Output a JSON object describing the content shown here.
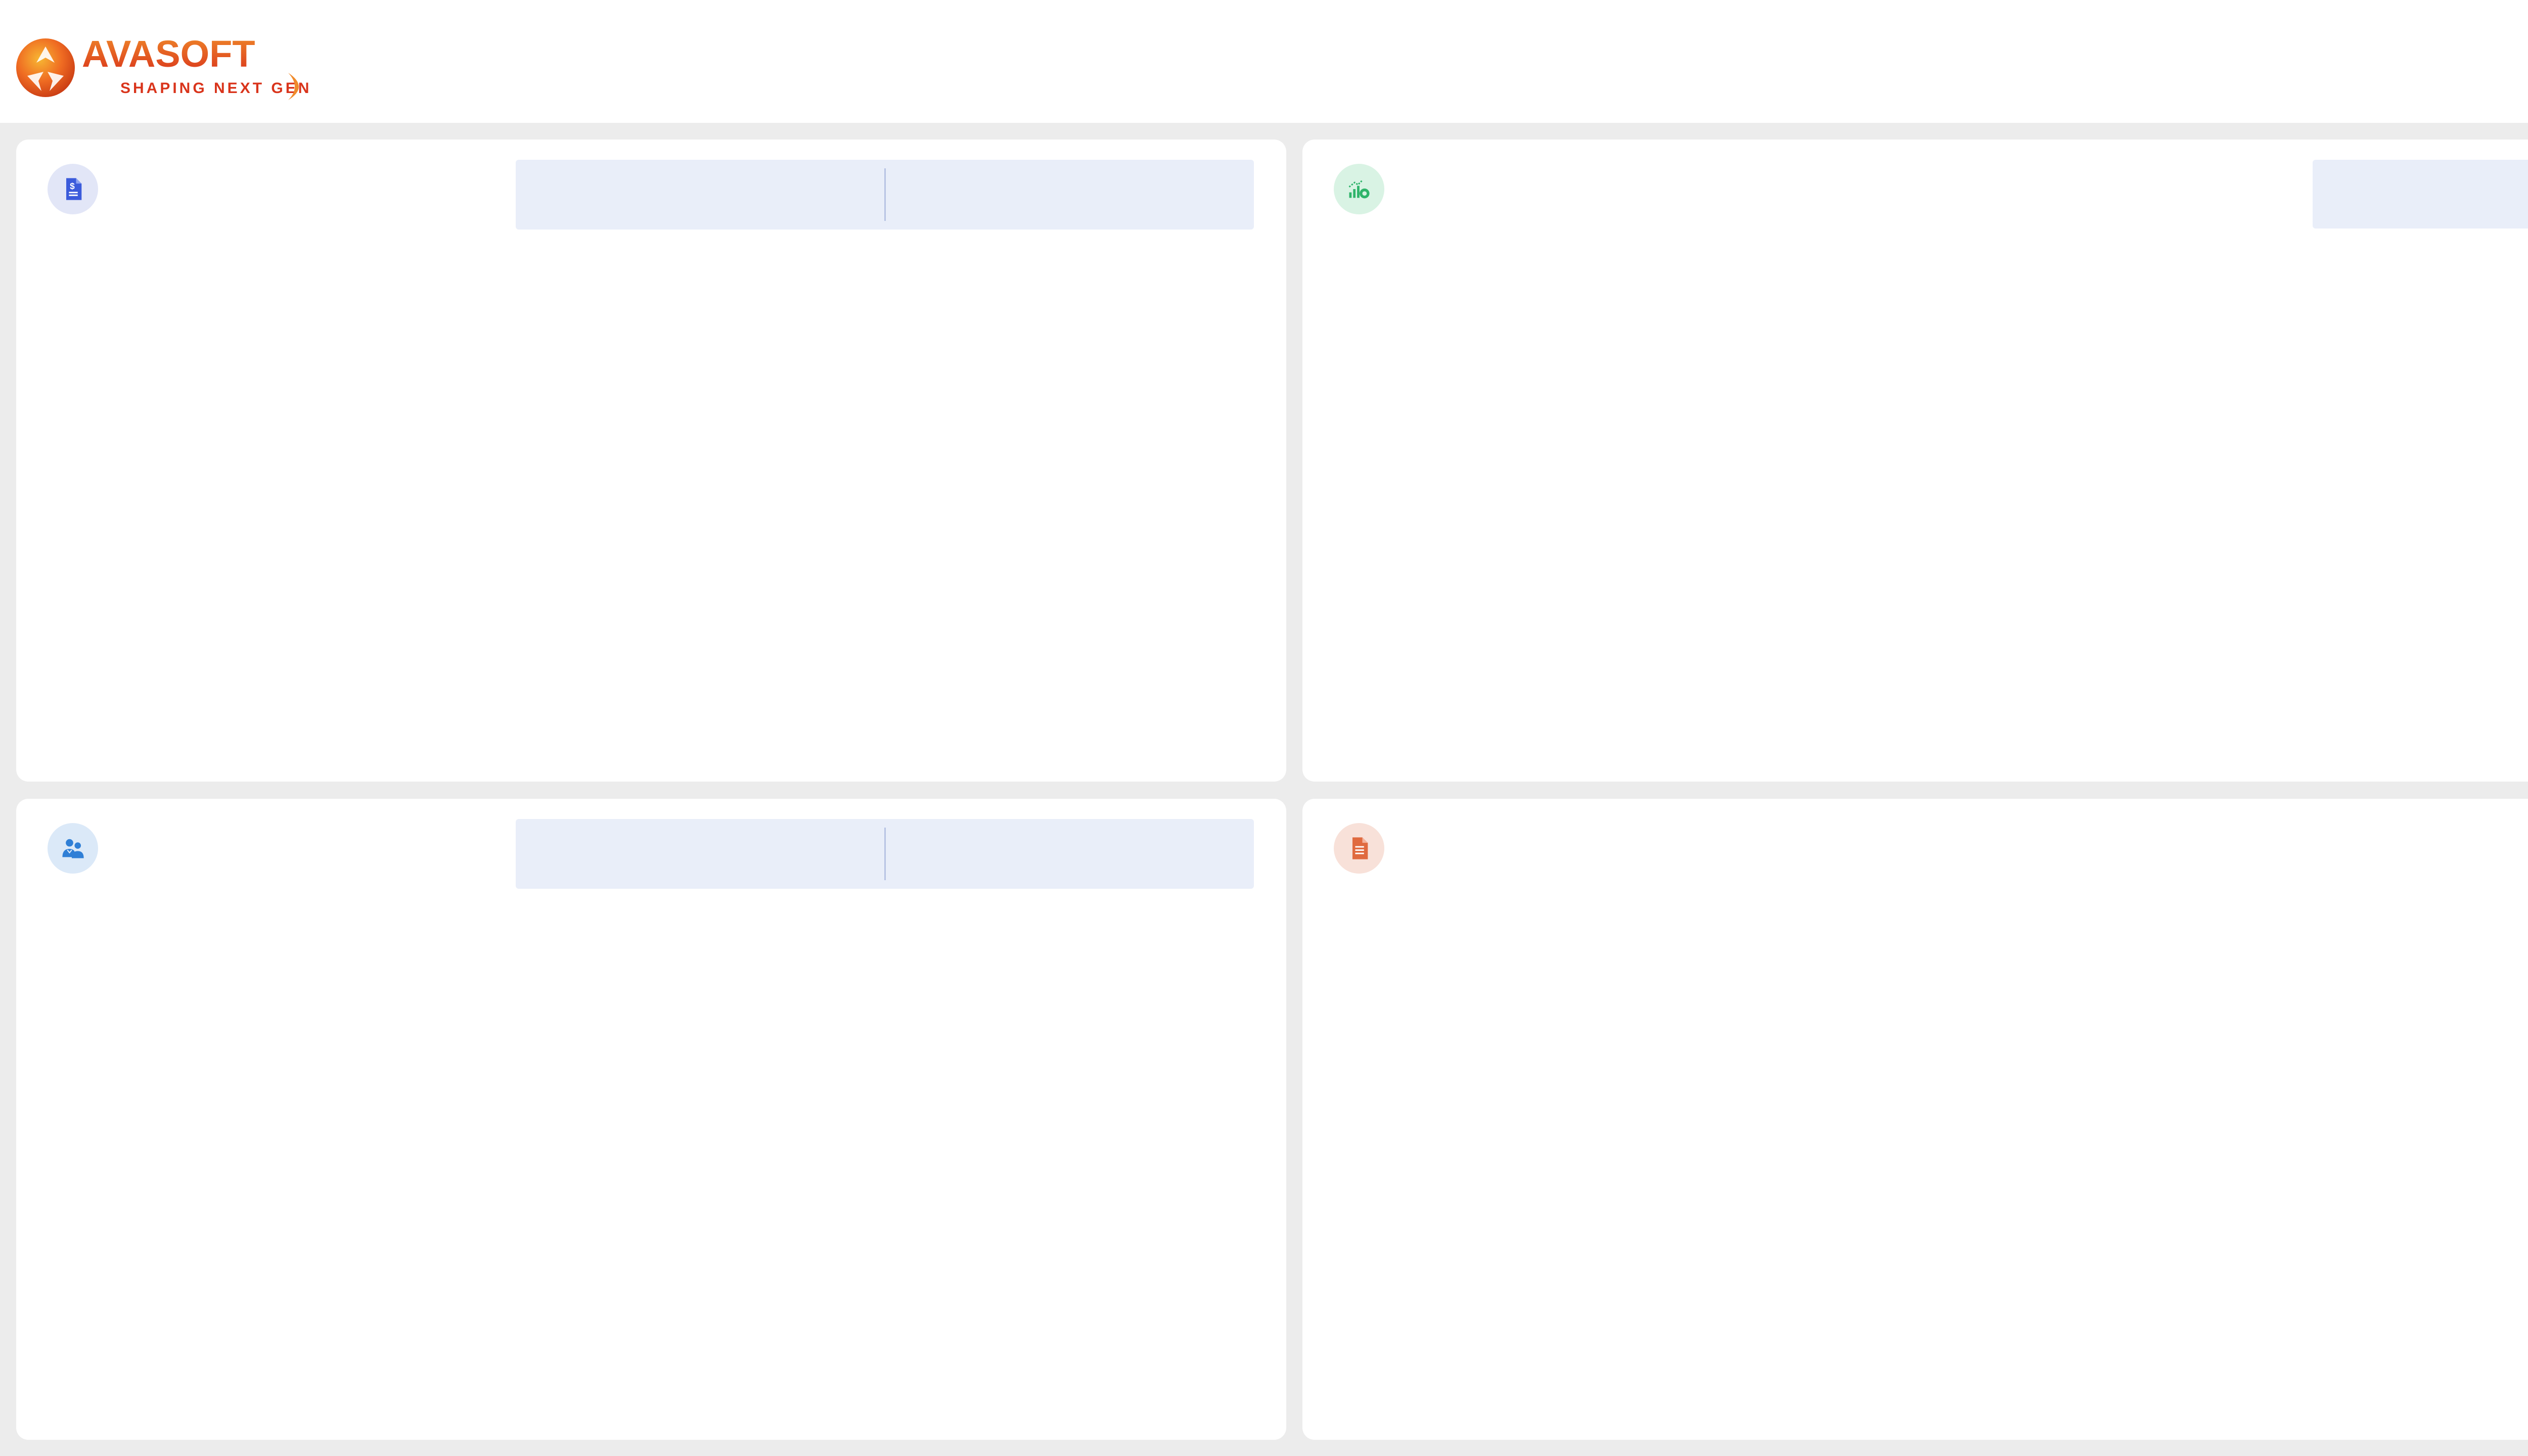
{
  "brand": {
    "name": "AVASOFT",
    "tagline": "SHAPING NEXT GEN",
    "colors": {
      "primary": "#e8501e",
      "accent": "#f5a623"
    }
  },
  "cards": [
    {
      "id": "invoice",
      "icon": "invoice-dollar-icon",
      "icon_color": "#3b5bdb",
      "title": "",
      "toggle": [
        "",
        ""
      ]
    },
    {
      "id": "analytics",
      "icon": "chart-click-icon",
      "icon_color": "#2fb46a",
      "title": "",
      "toggle": [
        ""
      ]
    },
    {
      "id": "users",
      "icon": "users-icon",
      "icon_color": "#2f7fd6",
      "title": "",
      "toggle": [
        "",
        ""
      ]
    },
    {
      "id": "document",
      "icon": "document-icon",
      "icon_color": "#e06a3f",
      "title": ""
    }
  ],
  "colors": {
    "page_bg": "#ececec",
    "card_bg": "#ffffff",
    "toggle_bg": "#e9eef9",
    "toggle_divider": "#b8c4e4"
  }
}
